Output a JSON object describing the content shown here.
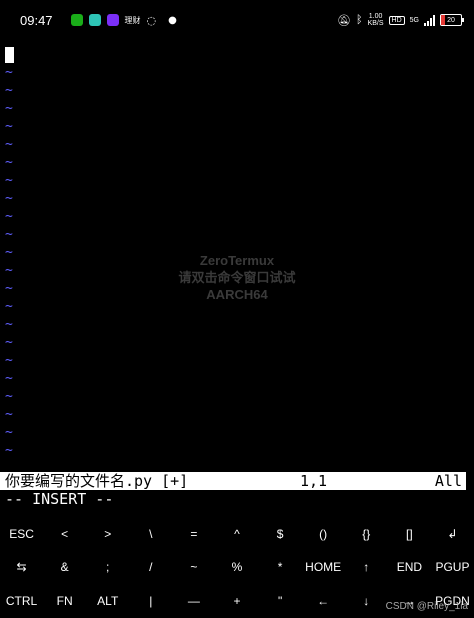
{
  "status_bar": {
    "time": "09:47",
    "app_icons": [
      {
        "name": "wechat-icon",
        "color": "#1aad19"
      },
      {
        "name": "soul-icon",
        "color": "#2ec4b6"
      },
      {
        "name": "app-icon",
        "color": "#7b2ff7"
      }
    ],
    "small_label": "理财",
    "network_speed_value": "1.00",
    "network_speed_unit": "KB/S",
    "hd_label": "HD",
    "signal_label": "5G",
    "battery_level": "20",
    "battery_color": "#e53935"
  },
  "terminal": {
    "tilde_char": "~",
    "tilde_color": "#5f5fff",
    "watermark": {
      "line1": "ZeroTermux",
      "line2": "请双击命令窗口试试",
      "line3": "AARCH64"
    },
    "statusline": {
      "filename": "你要编写的文件名.py [+]",
      "position": "1,1",
      "scroll": "All"
    },
    "mode": "-- INSERT --"
  },
  "extra_keys": [
    [
      "ESC",
      "<",
      ">",
      "\\",
      "=",
      "^",
      "$",
      "()",
      "{}",
      "[]",
      "↲"
    ],
    [
      "⇆",
      "&",
      ";",
      "/",
      "~",
      "%",
      "*",
      "HOME",
      "↑",
      "END",
      "PGUP"
    ],
    [
      "CTRL",
      "FN",
      "ALT",
      "|",
      "—",
      "+",
      "\"",
      "←",
      "↓",
      "→",
      "PGDN"
    ]
  ],
  "watermark_credit": "CSDN @Riley_1ia"
}
